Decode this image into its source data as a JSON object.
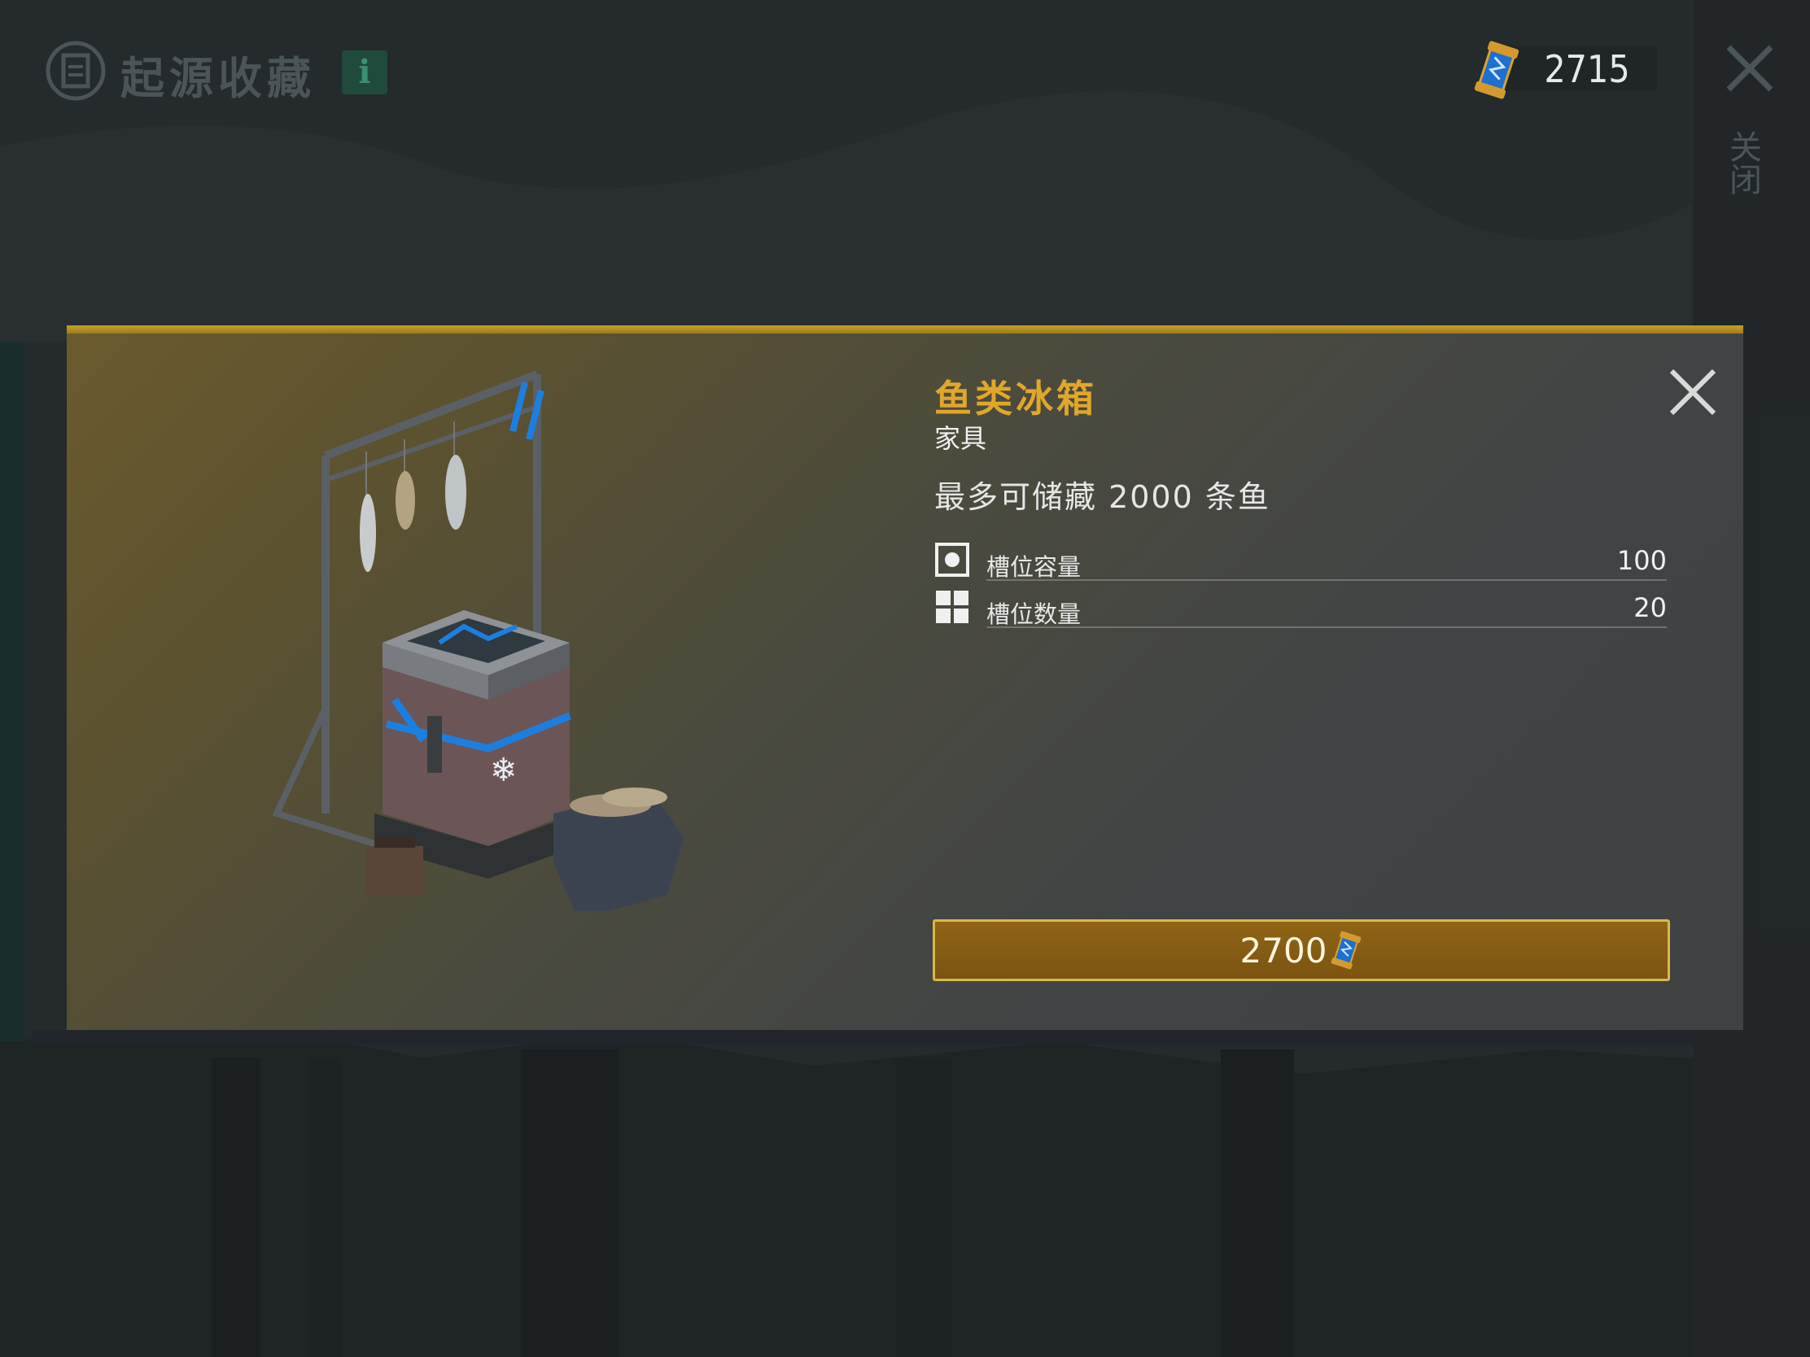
{
  "header": {
    "title": "起源收藏",
    "info_label": "i",
    "currency_value": "2715",
    "side_close_label": "关闭"
  },
  "item": {
    "name": "鱼类冰箱",
    "type": "家具",
    "description": "最多可储藏 2000 条鱼",
    "stats": [
      {
        "label": "槽位容量",
        "value": "100",
        "icon": "slot-capacity-icon"
      },
      {
        "label": "槽位数量",
        "value": "20",
        "icon": "slot-count-icon"
      }
    ],
    "price": "2700"
  },
  "colors": {
    "accent_gold": "#e0a72a",
    "button_bg": "#8f6416",
    "button_border": "#d9b84a"
  }
}
